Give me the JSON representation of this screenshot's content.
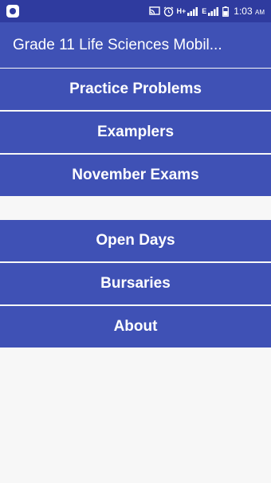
{
  "status_bar": {
    "network_label": "H+",
    "network_label_2": "E",
    "time": "1:03",
    "ampm": "AM"
  },
  "app_bar": {
    "title": "Grade 11 Life Sciences Mobil..."
  },
  "menu_primary": [
    {
      "label": "Practice Problems"
    },
    {
      "label": "Examplers"
    },
    {
      "label": "November Exams"
    }
  ],
  "menu_secondary": [
    {
      "label": "Open Days"
    },
    {
      "label": "Bursaries"
    },
    {
      "label": "About"
    }
  ],
  "colors": {
    "primary": "#3f51b5",
    "primary_dark": "#2f3b9f",
    "background": "#f7f7f7",
    "text_on_primary": "#ffffff"
  }
}
